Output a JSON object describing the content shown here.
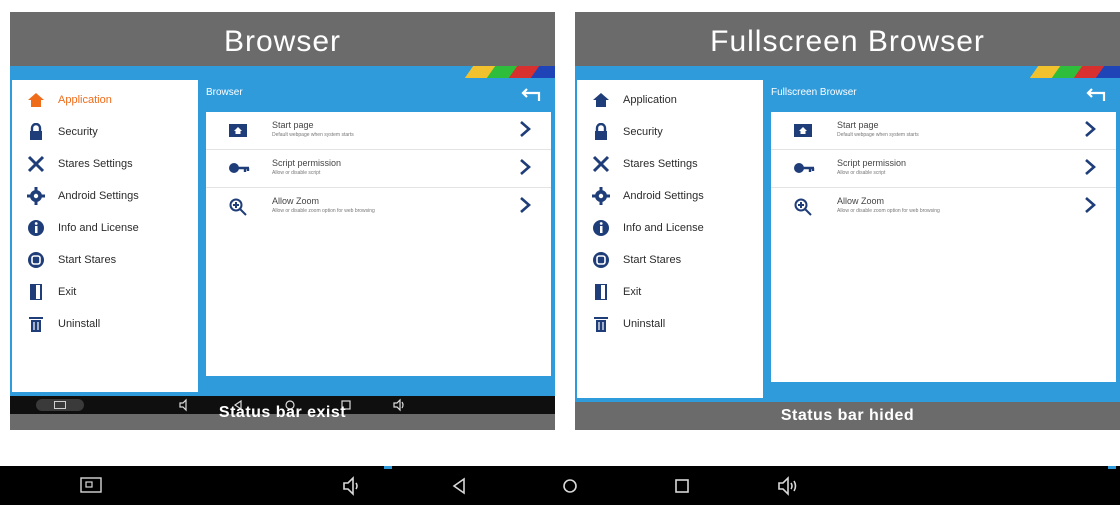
{
  "panels": {
    "left": {
      "title": "Browser",
      "caption": "Status bar exist",
      "content_title": "Browser"
    },
    "right": {
      "title": "Fullscreen Browser",
      "caption": "Status bar hided",
      "content_title": "Fullscreen Browser"
    }
  },
  "sidebar": {
    "items": [
      {
        "label": "Application",
        "icon": "home-icon"
      },
      {
        "label": "Security",
        "icon": "lock-icon"
      },
      {
        "label": "Stares Settings",
        "icon": "tools-icon"
      },
      {
        "label": "Android Settings",
        "icon": "gear-icon"
      },
      {
        "label": "Info and License",
        "icon": "info-icon"
      },
      {
        "label": "Start Stares",
        "icon": "start-icon"
      },
      {
        "label": "Exit",
        "icon": "exit-icon"
      },
      {
        "label": "Uninstall",
        "icon": "trash-icon"
      }
    ]
  },
  "settings_left": [
    {
      "title": "Start page",
      "subtitle": "Default webpage when system starts",
      "icon": "home-page-icon"
    },
    {
      "title": "Script permission",
      "subtitle": "Allow or disable script",
      "icon": "key-icon"
    },
    {
      "title": "Allow Zoom",
      "subtitle": "Allow or disable zoom option for web browsing",
      "icon": "zoom-icon"
    }
  ],
  "settings_right": [
    {
      "title": "Start page",
      "subtitle": "Default webpage when system starts",
      "icon": "home-page-icon"
    },
    {
      "title": "Script permission",
      "subtitle": "Allow or disable script",
      "icon": "key-icon"
    },
    {
      "title": "Allow Zoom",
      "subtitle": "Allow or disable zoom option for web browsing",
      "icon": "zoom-icon"
    }
  ],
  "colors": {
    "panel_bg": "#6b6b6b",
    "accent_blue": "#2f9bdb",
    "active_orange": "#ef6c1a",
    "navbar": "#0f0f0f"
  }
}
